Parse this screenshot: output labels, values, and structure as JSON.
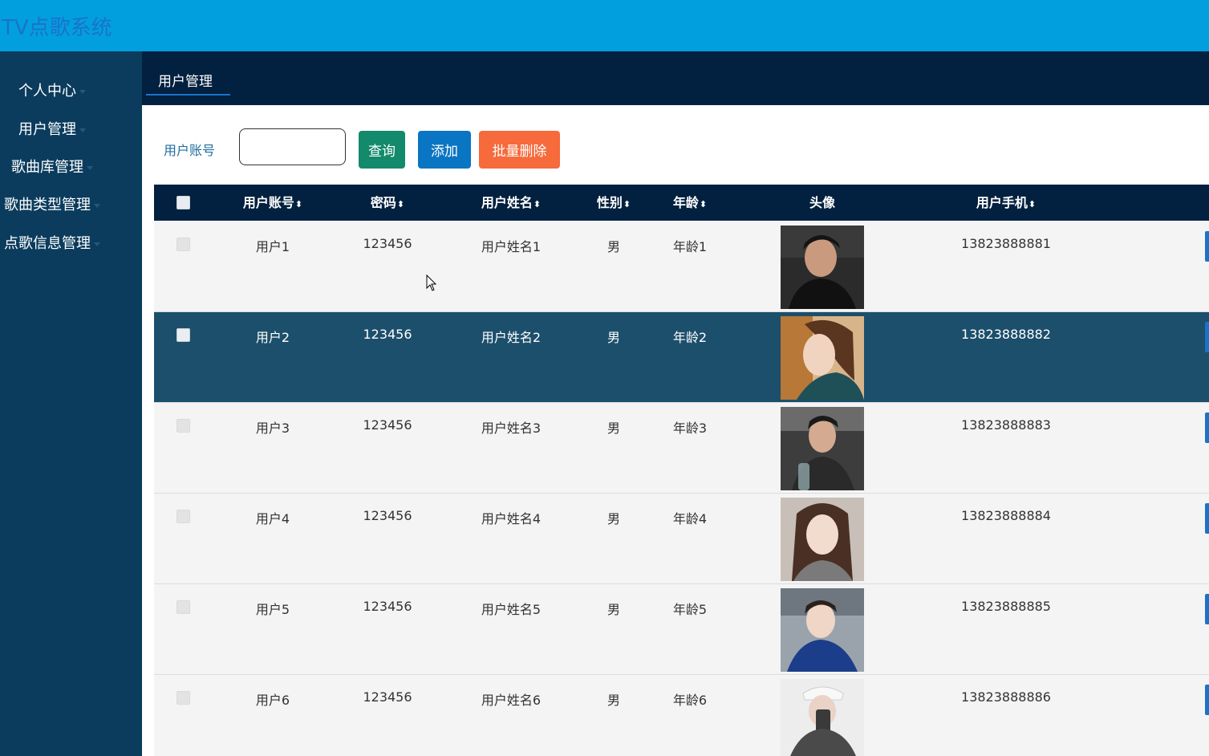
{
  "app": {
    "title": "TV点歌系统"
  },
  "sidebar": {
    "items": [
      {
        "label": "个人中心"
      },
      {
        "label": "用户管理"
      },
      {
        "label": "歌曲库管理"
      },
      {
        "label": "歌曲类型管理"
      },
      {
        "label": "点歌信息管理"
      }
    ]
  },
  "tabs": {
    "active": "用户管理"
  },
  "search": {
    "label": "用户账号",
    "value": "",
    "placeholder": ""
  },
  "actions": {
    "query": "查询",
    "add": "添加",
    "batch_delete": "批量删除"
  },
  "table": {
    "sort_glyph": "⬍",
    "headers": {
      "account": "用户账号",
      "password": "密码",
      "name": "用户姓名",
      "gender": "性别",
      "age": "年龄",
      "avatar": "头像",
      "phone": "用户手机"
    },
    "rows": [
      {
        "account": "用户1",
        "password": "123456",
        "name": "用户姓名1",
        "gender": "男",
        "age": "年龄1",
        "phone": "13823888881"
      },
      {
        "account": "用户2",
        "password": "123456",
        "name": "用户姓名2",
        "gender": "男",
        "age": "年龄2",
        "phone": "13823888882"
      },
      {
        "account": "用户3",
        "password": "123456",
        "name": "用户姓名3",
        "gender": "男",
        "age": "年龄3",
        "phone": "13823888883"
      },
      {
        "account": "用户4",
        "password": "123456",
        "name": "用户姓名4",
        "gender": "男",
        "age": "年龄4",
        "phone": "13823888884"
      },
      {
        "account": "用户5",
        "password": "123456",
        "name": "用户姓名5",
        "gender": "男",
        "age": "年龄5",
        "phone": "13823888885"
      },
      {
        "account": "用户6",
        "password": "123456",
        "name": "用户姓名6",
        "gender": "男",
        "age": "年龄6",
        "phone": "13823888886"
      }
    ]
  }
}
